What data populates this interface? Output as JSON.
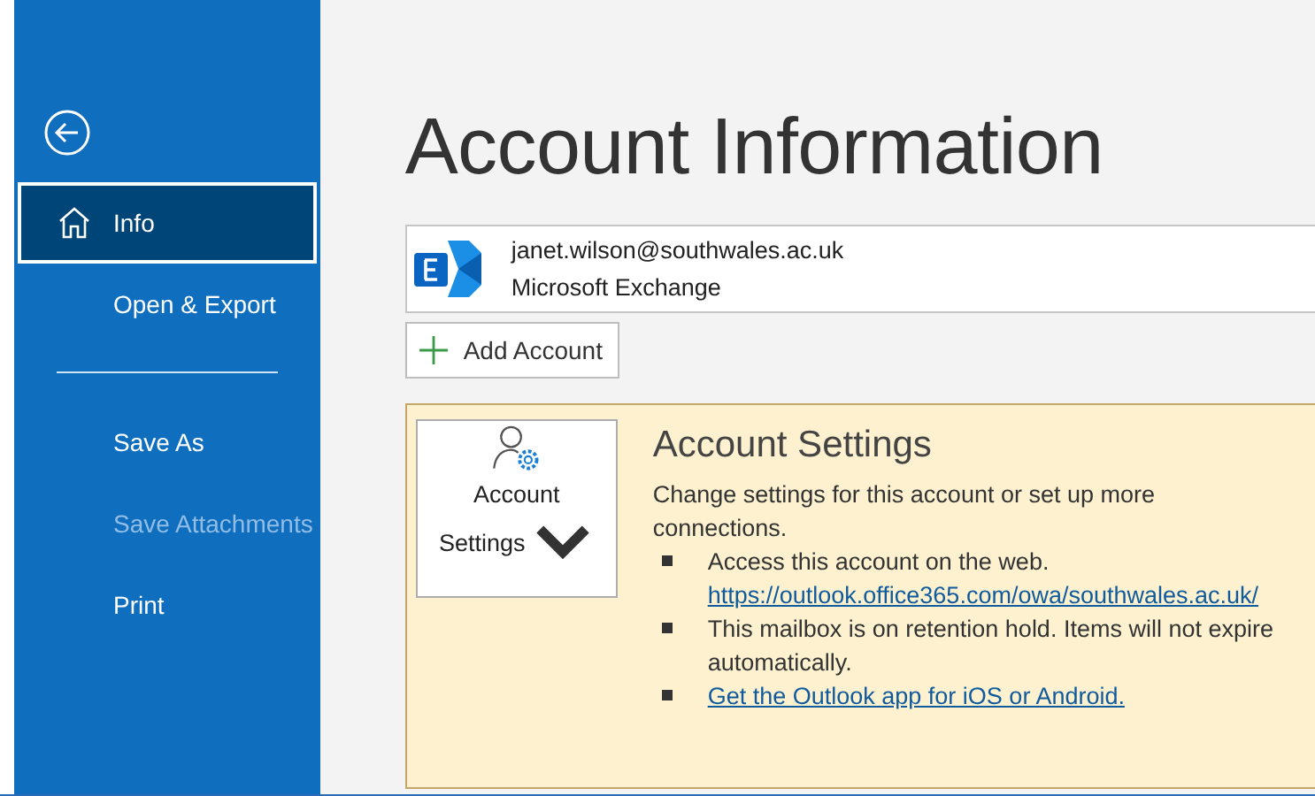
{
  "sidebar": {
    "items": [
      {
        "kind": "home",
        "label": "Info",
        "selected": true,
        "disabled": false
      },
      {
        "kind": "page",
        "label": "Open & Export",
        "selected": false,
        "disabled": false
      },
      {
        "kind": "separator"
      },
      {
        "kind": "page",
        "label": "Save As",
        "selected": false,
        "disabled": false
      },
      {
        "kind": "page",
        "label": "Save Attachments",
        "selected": false,
        "disabled": true
      },
      {
        "kind": "page",
        "label": "Print",
        "selected": false,
        "disabled": false
      }
    ]
  },
  "title": "Account Information",
  "account": {
    "email": "janet.wilson@southwales.ac.uk",
    "type": "Microsoft Exchange"
  },
  "add_account_button": "Add Account",
  "account_settings": {
    "button_lines": [
      "Account",
      "Settings"
    ],
    "heading": "Account Settings",
    "description": "Change settings for this account or set up more connections.",
    "bullets": [
      {
        "text": "Access this account on the web.",
        "link": "https://outlook.office365.com/owa/southwales.ac.uk/"
      },
      {
        "text": "This mailbox is on retention hold. Items will not expire automatically."
      },
      {
        "link": "Get the Outlook app for iOS or Android."
      }
    ]
  }
}
